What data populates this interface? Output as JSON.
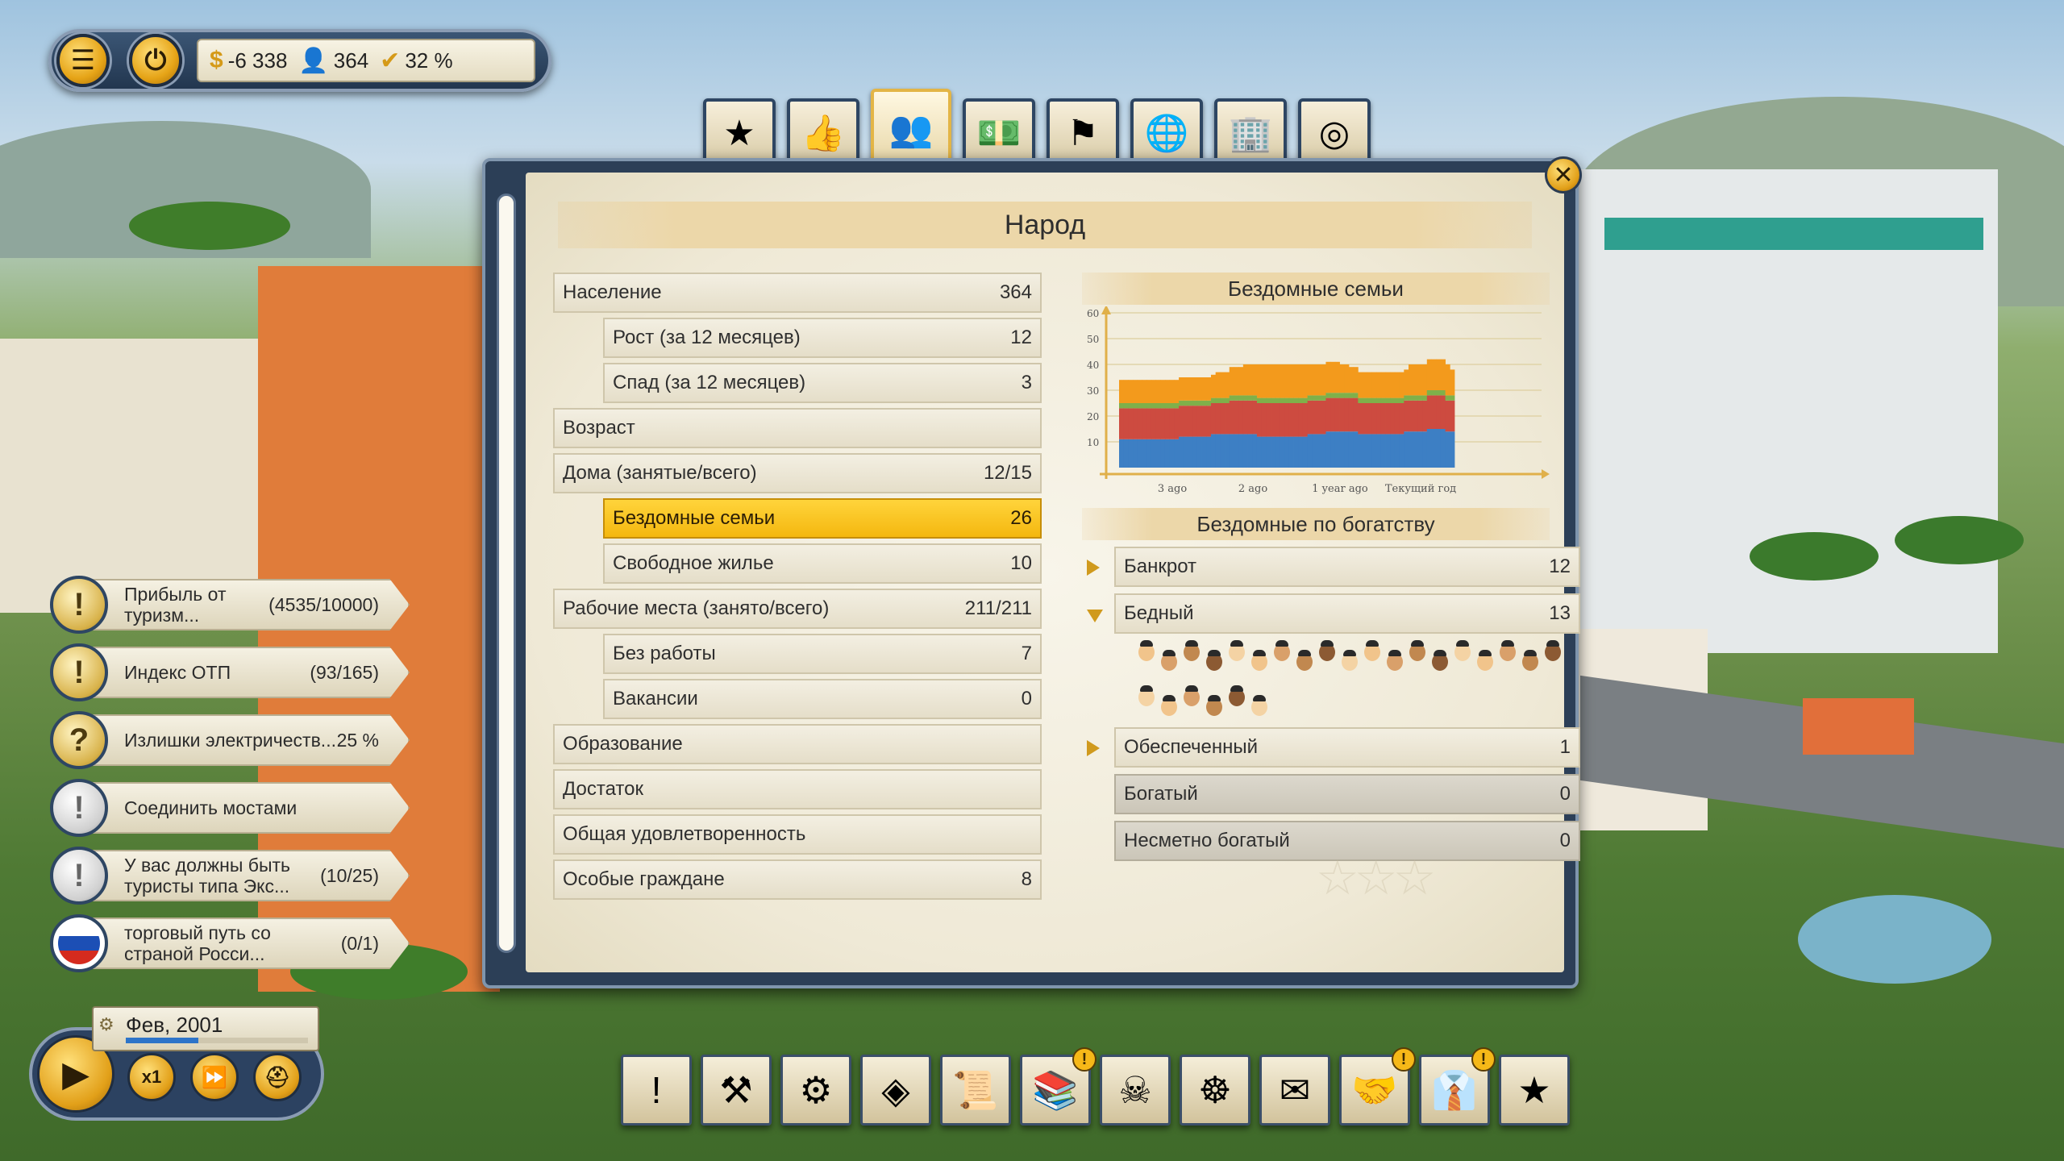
{
  "resources": {
    "money": "-6 338",
    "population": "364",
    "approval": "32 %"
  },
  "menu_icons": {
    "menu": "hamburger-icon",
    "power": "power-icon"
  },
  "tabs": [
    {
      "icon": "faction-star-icon",
      "active": false
    },
    {
      "icon": "thumbs-up-icon",
      "active": false
    },
    {
      "icon": "people-portrait-icon",
      "active": true
    },
    {
      "icon": "money-icon",
      "active": false
    },
    {
      "icon": "flag-icon",
      "active": false
    },
    {
      "icon": "globe-icon",
      "active": false
    },
    {
      "icon": "buildings-icon",
      "active": false
    },
    {
      "icon": "target-icon",
      "active": false
    }
  ],
  "panel": {
    "title": "Народ",
    "close": "✕"
  },
  "stats": [
    {
      "label": "Население",
      "value": "364",
      "sub": false,
      "highlight": false
    },
    {
      "label": "Рост (за 12 месяцев)",
      "value": "12",
      "sub": true,
      "highlight": false
    },
    {
      "label": "Спад (за 12 месяцев)",
      "value": "3",
      "sub": true,
      "highlight": false
    },
    {
      "label": "Возраст",
      "value": "",
      "sub": false,
      "highlight": false
    },
    {
      "label": "Дома (занятые/всего)",
      "value": "12/15",
      "sub": false,
      "highlight": false
    },
    {
      "label": "Бездомные семьи",
      "value": "26",
      "sub": true,
      "highlight": true
    },
    {
      "label": "Свободное жилье",
      "value": "10",
      "sub": true,
      "highlight": false
    },
    {
      "label": "Рабочие места (занято/всего)",
      "value": "211/211",
      "sub": false,
      "highlight": false
    },
    {
      "label": "Без работы",
      "value": "7",
      "sub": true,
      "highlight": false
    },
    {
      "label": "Вакансии",
      "value": "0",
      "sub": true,
      "highlight": false
    },
    {
      "label": "Образование",
      "value": "",
      "sub": false,
      "highlight": false
    },
    {
      "label": "Достаток",
      "value": "",
      "sub": false,
      "highlight": false
    },
    {
      "label": "Общая удовлетворенность",
      "value": "",
      "sub": false,
      "highlight": false
    },
    {
      "label": "Особые граждане",
      "value": "8",
      "sub": false,
      "highlight": false
    }
  ],
  "chart_data": {
    "type": "bar",
    "title": "Бездомные семьи",
    "stacked": true,
    "ylim": [
      0,
      60
    ],
    "y_ticks": [
      "10",
      "20",
      "30",
      "40",
      "50",
      "60"
    ],
    "x_tick_labels": [
      "3 ago",
      "2 ago",
      "1 year ago",
      "Текущий год"
    ],
    "grid": true,
    "colors": {
      "blue": "#3d7fc4",
      "red": "#cd4b40",
      "green": "#7fb04a",
      "orange": "#f39a1c"
    },
    "series": [
      {
        "color": "blue",
        "values": [
          11,
          11,
          11,
          11,
          11,
          11,
          11,
          11,
          11,
          11,
          11,
          11,
          11,
          12,
          12,
          12,
          12,
          12,
          12,
          12,
          13,
          13,
          13,
          13,
          13,
          13,
          13,
          13,
          13,
          13,
          12,
          12,
          12,
          12,
          12,
          12,
          12,
          12,
          12,
          12,
          12,
          13,
          13,
          13,
          13,
          14,
          14,
          14,
          14,
          14,
          14,
          14,
          13,
          13,
          13,
          13,
          13,
          13,
          13,
          13,
          13,
          13,
          14,
          14,
          14,
          14,
          14,
          15,
          15,
          15,
          15,
          14,
          14
        ]
      },
      {
        "color": "red",
        "values": [
          12,
          12,
          12,
          12,
          12,
          12,
          12,
          12,
          12,
          12,
          12,
          12,
          12,
          12,
          12,
          12,
          12,
          12,
          12,
          12,
          12,
          12,
          12,
          12,
          13,
          13,
          13,
          13,
          13,
          13,
          13,
          13,
          13,
          13,
          13,
          13,
          13,
          13,
          13,
          13,
          13,
          13,
          13,
          13,
          13,
          13,
          13,
          13,
          13,
          13,
          13,
          13,
          12,
          12,
          12,
          12,
          12,
          12,
          12,
          12,
          12,
          12,
          12,
          12,
          12,
          12,
          12,
          13,
          13,
          13,
          13,
          12,
          12
        ]
      },
      {
        "color": "green",
        "values": [
          2,
          2,
          2,
          2,
          2,
          2,
          2,
          2,
          2,
          2,
          2,
          2,
          2,
          2,
          2,
          2,
          2,
          2,
          2,
          2,
          2,
          2,
          2,
          2,
          2,
          2,
          2,
          2,
          2,
          2,
          2,
          2,
          2,
          2,
          2,
          2,
          2,
          2,
          2,
          2,
          2,
          2,
          2,
          2,
          2,
          2,
          2,
          2,
          2,
          2,
          2,
          2,
          2,
          2,
          2,
          2,
          2,
          2,
          2,
          2,
          2,
          2,
          2,
          2,
          2,
          2,
          2,
          2,
          2,
          2,
          2,
          2,
          2
        ]
      },
      {
        "color": "orange",
        "values": [
          9,
          9,
          9,
          9,
          9,
          9,
          9,
          9,
          9,
          9,
          9,
          9,
          9,
          9,
          9,
          9,
          9,
          9,
          9,
          9,
          9,
          10,
          10,
          10,
          11,
          11,
          11,
          12,
          12,
          12,
          13,
          13,
          13,
          13,
          13,
          13,
          13,
          13,
          13,
          13,
          13,
          12,
          12,
          12,
          12,
          12,
          12,
          12,
          11,
          11,
          10,
          10,
          10,
          10,
          10,
          10,
          10,
          10,
          10,
          10,
          10,
          10,
          10,
          12,
          12,
          12,
          12,
          12,
          12,
          12,
          12,
          12,
          10
        ]
      }
    ]
  },
  "wealth": {
    "title": "Бездомные по богатству",
    "rows": [
      {
        "label": "Банкрот",
        "value": "12",
        "arrow": "right",
        "dim": false
      },
      {
        "label": "Бедный",
        "value": "13",
        "arrow": "down",
        "dim": false
      },
      {
        "label": "Обеспеченный",
        "value": "1",
        "arrow": "right",
        "dim": false
      },
      {
        "label": "Богатый",
        "value": "0",
        "arrow": "",
        "dim": true
      },
      {
        "label": "Несметно богатый",
        "value": "0",
        "arrow": "",
        "dim": true
      }
    ]
  },
  "quests": [
    {
      "icon": "exclamation-icon",
      "glyph": "!",
      "label": "Прибыль от туризм...",
      "value": "(4535/10000)",
      "grey": false
    },
    {
      "icon": "exclamation-icon",
      "glyph": "!",
      "label": "Индекс ОТП",
      "value": "(93/165)",
      "grey": false
    },
    {
      "icon": "question-icon",
      "glyph": "?",
      "label": "Излишки электричеств...",
      "value": "25 %",
      "grey": false
    },
    {
      "icon": "exclamation-icon",
      "glyph": "!",
      "label": "Соединить мостами",
      "value": "",
      "grey": true
    },
    {
      "icon": "exclamation-icon",
      "glyph": "!",
      "label": "У вас должны быть туристы типа Экс...",
      "value": "(10/25)",
      "grey": true
    },
    {
      "icon": "russia-flag-icon",
      "glyph": "",
      "label": "торговый путь со страной Росси...",
      "value": "(0/1)",
      "grey": false
    }
  ],
  "date": {
    "text": "Фев, 2001",
    "progress": 0.4
  },
  "speed_controls": {
    "play": "▶",
    "speed": "x1"
  },
  "toolbar": [
    {
      "icon": "exclamation-icon",
      "glyph": "!",
      "alert": false
    },
    {
      "icon": "hammer-icon",
      "glyph": "⚒",
      "alert": false
    },
    {
      "icon": "almanac-icon",
      "glyph": "⚙",
      "alert": false
    },
    {
      "icon": "map-overlay-icon",
      "glyph": "◈",
      "alert": false
    },
    {
      "icon": "scroll-icon",
      "glyph": "📜",
      "alert": false
    },
    {
      "icon": "books-icon",
      "glyph": "📚",
      "alert": true
    },
    {
      "icon": "pirate-flag-icon",
      "glyph": "☠",
      "alert": false
    },
    {
      "icon": "ship-wheel-icon",
      "glyph": "☸",
      "alert": false
    },
    {
      "icon": "edict-icon",
      "glyph": "✉",
      "alert": false
    },
    {
      "icon": "diplomacy-icon",
      "glyph": "🤝",
      "alert": true
    },
    {
      "icon": "president-icon",
      "glyph": "👔",
      "alert": true
    },
    {
      "icon": "faction-star-icon",
      "glyph": "★",
      "alert": false
    }
  ],
  "alert_glyph": "!"
}
